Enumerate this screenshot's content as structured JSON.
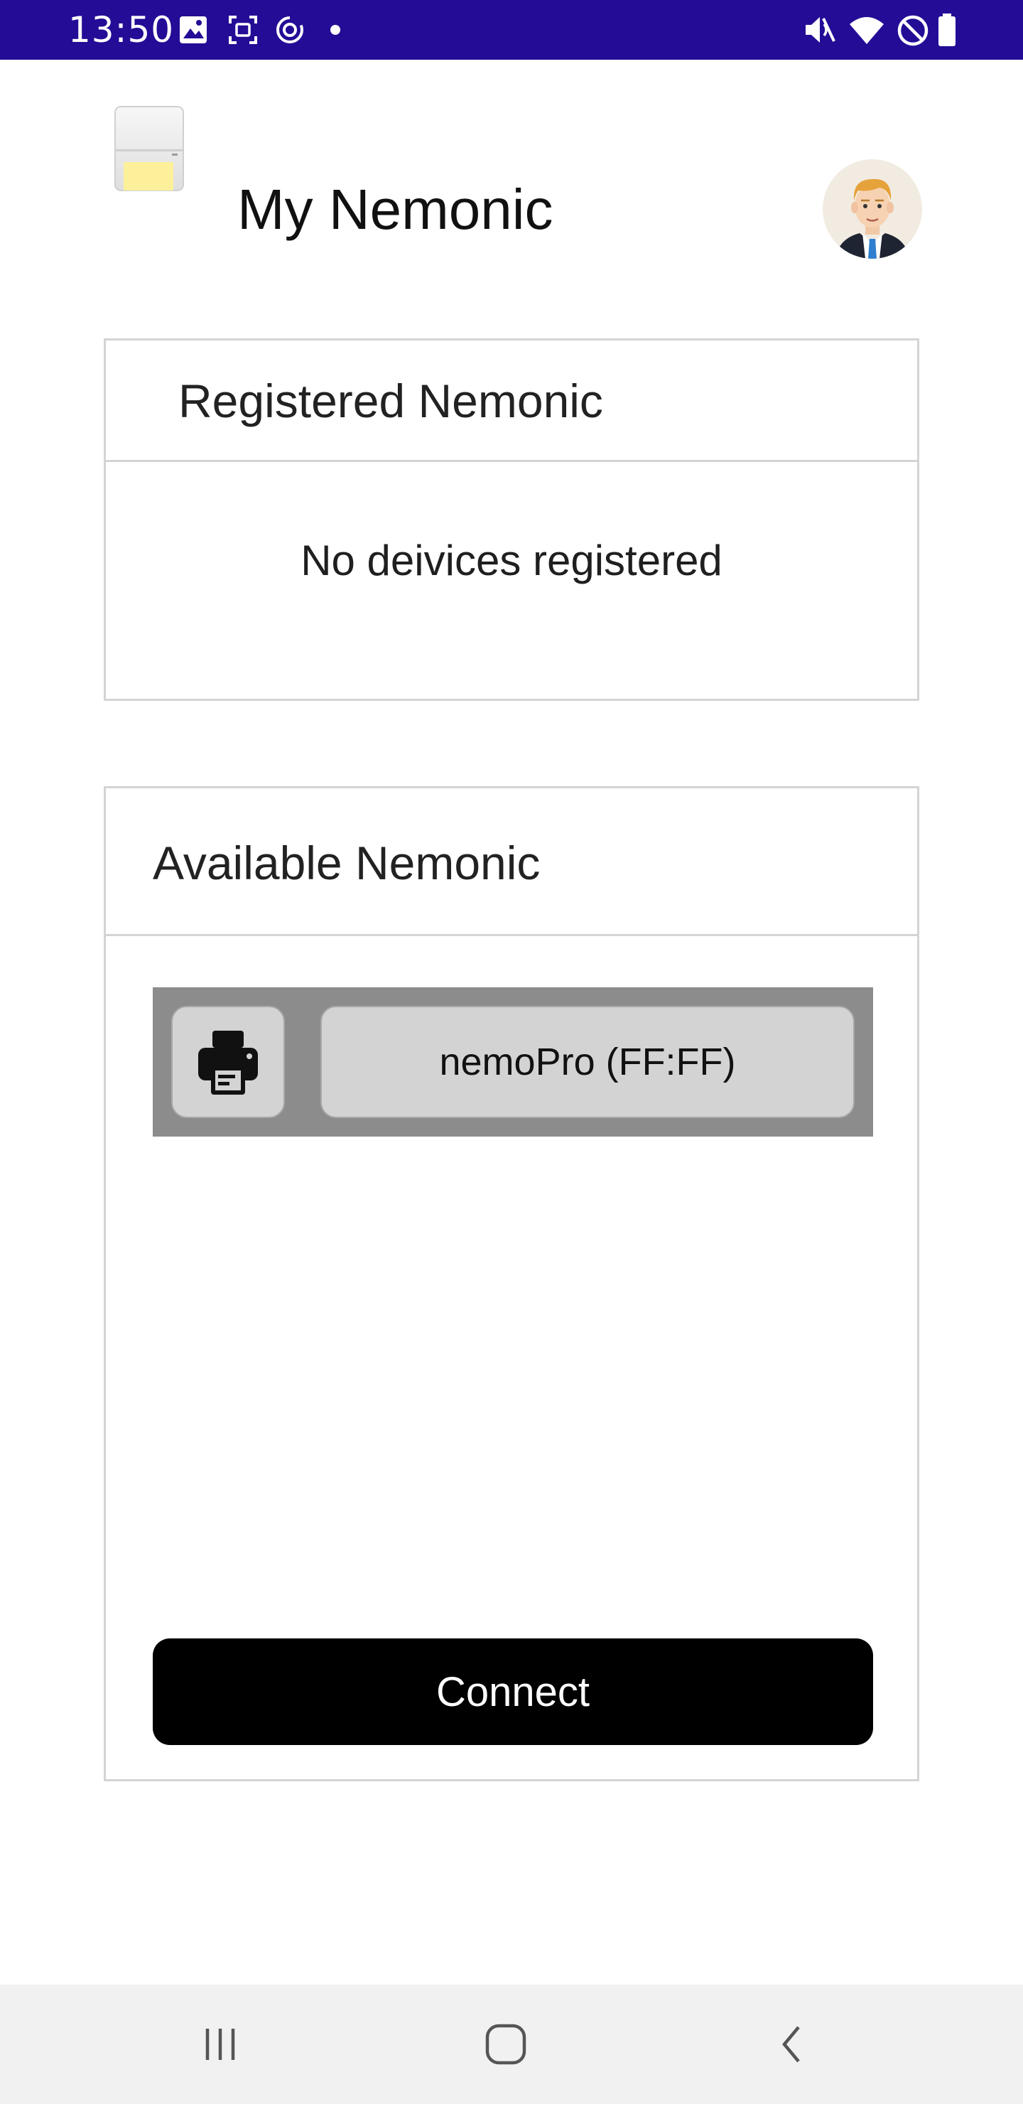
{
  "status_bar": {
    "time": "13:50",
    "background": "#240c96",
    "left_icons": [
      "image-icon",
      "screenshot-icon",
      "sync-icon",
      "dot-icon"
    ],
    "right_icons": [
      "mute-icon",
      "wifi-icon",
      "do-not-disturb-icon",
      "battery-icon"
    ]
  },
  "header": {
    "logo_icon": "printer-logo-icon",
    "title": "My Nemonic",
    "avatar_icon": "user-avatar-icon"
  },
  "registered": {
    "title": "Registered Nemonic",
    "empty_message": "No deivices registered"
  },
  "available": {
    "title": "Available Nemonic",
    "devices": [
      {
        "icon": "printer-icon",
        "name": "nemoPro (FF:FF)"
      }
    ],
    "connect_label": "Connect"
  },
  "nav_bar": {
    "items": [
      "recent-apps-icon",
      "home-icon",
      "back-icon"
    ]
  }
}
